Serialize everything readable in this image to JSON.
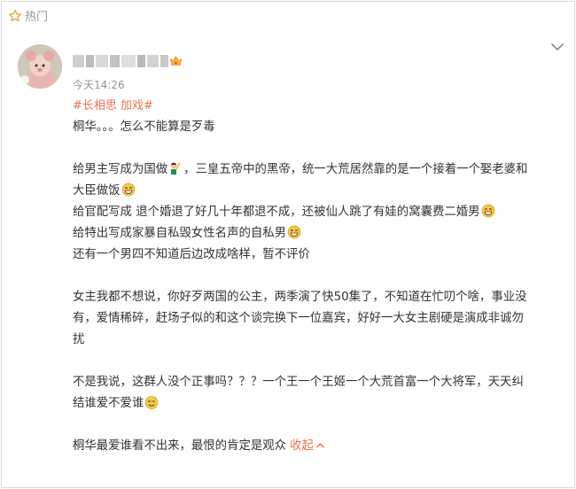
{
  "header": {
    "hot_label": "热门"
  },
  "post": {
    "time": "今天14:26",
    "topic": "#长相思 加戏#",
    "lines": [
      {
        "text": "桐华。。。怎么不能算是歹毒"
      },
      {
        "text": ""
      },
      {
        "text": "给男主写成为国做",
        "emoji": "man-raising-hand-emoji",
        "tail": "，三皇五帝中的黑帝，统一大荒居然靠的是一个接着一个娶老婆和"
      },
      {
        "text": "大臣做饭",
        "emoji": "grin-sweat-emoji",
        "tail": ""
      },
      {
        "text": "给官配写成 退个婚退了好几十年都退不成，还被仙人跳了有娃的窝囊费二婚男",
        "emoji": "grin-sweat-emoji",
        "tail": ""
      },
      {
        "text": "给特出写成家暴自私毁女性名声的自私男",
        "emoji": "grin-sweat-emoji",
        "tail": ""
      },
      {
        "text": "还有一个男四不知道后边改成啥样，暂不评价"
      },
      {
        "text": ""
      },
      {
        "text": "女主我都不想说，你好歹两国的公主，两季演了快50集了，不知道在忙叨个啥，事业没"
      },
      {
        "text": "有，爱情稀碎，赶场子似的和这个谈完换下一位嘉宾，好好一大女主剧硬是演成非诚勿"
      },
      {
        "text": "扰"
      },
      {
        "text": ""
      },
      {
        "text": "不是我说，这群人没个正事吗？？？一个王一个王姬一个大荒首富一个大将军，天天纠"
      },
      {
        "text": "结谁爱不爱谁",
        "emoji": "sweat-smile-emoji",
        "tail": ""
      },
      {
        "text": ""
      },
      {
        "text": "桐华最爱谁看不出来，最恨的肯定是观众"
      }
    ],
    "collapse_label": "收起"
  },
  "colors": {
    "accent": "#eb7350",
    "text": "#333333",
    "muted": "#939393"
  }
}
